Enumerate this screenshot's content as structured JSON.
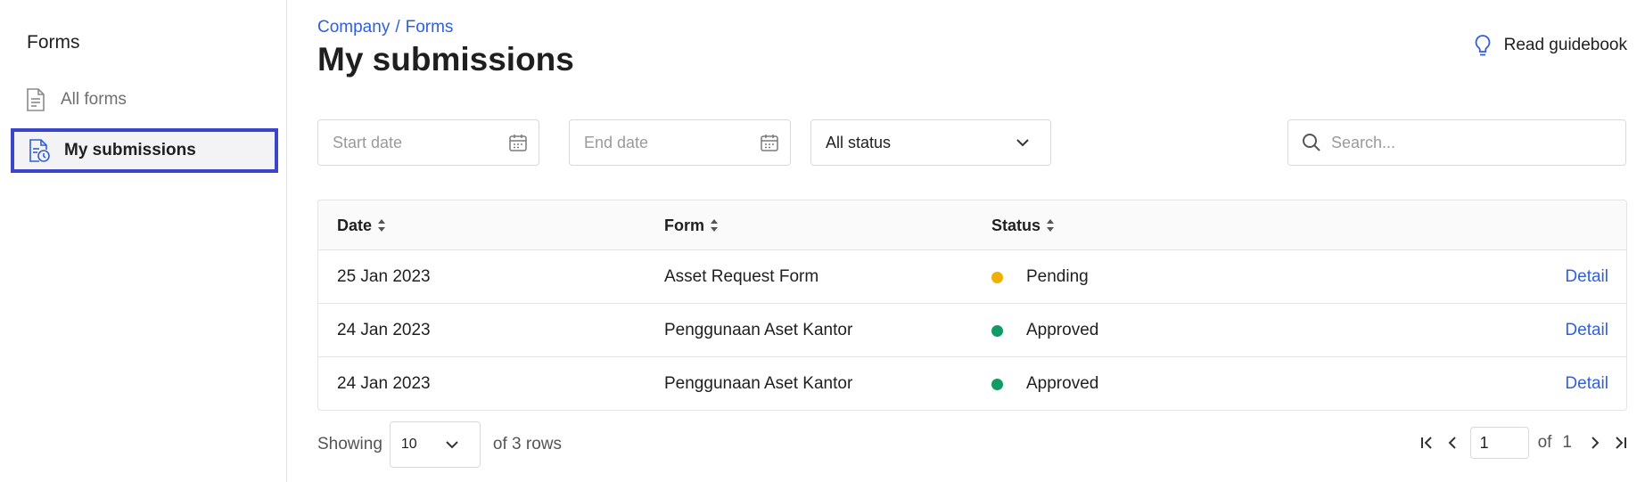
{
  "sidebar": {
    "title": "Forms",
    "items": [
      {
        "label": "All forms",
        "icon": "document-icon"
      },
      {
        "label": "My submissions",
        "icon": "document-clock-icon"
      }
    ]
  },
  "header": {
    "breadcrumb": [
      "Company",
      "Forms"
    ],
    "breadcrumb_separator": "/",
    "title": "My submissions",
    "guide_label": "Read guidebook"
  },
  "filters": {
    "start_date_placeholder": "Start date",
    "end_date_placeholder": "End date",
    "status_value": "All status",
    "search_placeholder": "Search..."
  },
  "table": {
    "columns": [
      "Date",
      "Form",
      "Status"
    ],
    "rows": [
      {
        "date": "25 Jan 2023",
        "form": "Asset Request Form",
        "status": "Pending",
        "status_color": "#f0b000",
        "action": "Detail"
      },
      {
        "date": "24 Jan 2023",
        "form": "Penggunaan Aset Kantor",
        "status": "Approved",
        "status_color": "#0e9b65",
        "action": "Detail"
      },
      {
        "date": "24 Jan 2023",
        "form": "Penggunaan Aset Kantor",
        "status": "Approved",
        "status_color": "#0e9b65",
        "action": "Detail"
      }
    ]
  },
  "footer": {
    "showing_label": "Showing",
    "page_size": "10",
    "rows_label": "of 3 rows",
    "current_page": "1",
    "of_label": "of",
    "total_pages": "1"
  },
  "colors": {
    "accent": "#2f5fdc",
    "active_border": "#3b45c8",
    "pending": "#f0b000",
    "approved": "#0e9b65"
  }
}
